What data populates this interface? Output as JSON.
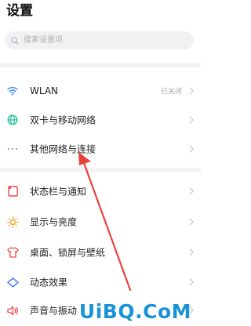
{
  "header": {
    "title": "设置"
  },
  "search": {
    "placeholder": "搜索设置项",
    "icon": "search-icon"
  },
  "groups": [
    {
      "items": [
        {
          "name": "wlan",
          "label": "WLAN",
          "value": "已关闭",
          "icon": "wifi-icon",
          "color": "#3a8ef0"
        },
        {
          "name": "dual-sim",
          "label": "双卡与移动网络",
          "icon": "globe-icon",
          "color": "#22c29a"
        },
        {
          "name": "other-networks",
          "label": "其他网络与连接",
          "icon": "more-dots-icon",
          "color": "#9a9aa0"
        }
      ]
    },
    {
      "items": [
        {
          "name": "status-bar",
          "label": "状态栏与通知",
          "icon": "notification-icon",
          "color": "#f0474a"
        },
        {
          "name": "display",
          "label": "显示与亮度",
          "icon": "sun-icon",
          "color": "#f5a623"
        },
        {
          "name": "desktop",
          "label": "桌面、锁屏与壁纸",
          "icon": "shirt-icon",
          "color": "#f0474a"
        },
        {
          "name": "dynamic-effects",
          "label": "动态效果",
          "icon": "diamond-icon",
          "color": "#3a6ff0"
        },
        {
          "name": "sound",
          "label": "声音与振动",
          "icon": "speaker-icon",
          "color": "#f0474a"
        }
      ]
    }
  ],
  "watermark": {
    "text": "UiBQ.CoM",
    "color": "#1a93d6"
  },
  "annotation": {
    "color": "#e8413a"
  }
}
